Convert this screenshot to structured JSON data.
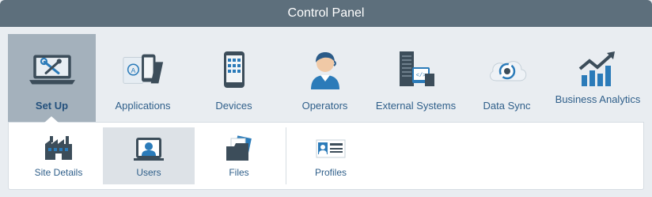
{
  "window": {
    "title": "Control Panel"
  },
  "nav": {
    "items": [
      {
        "label": "Set Up",
        "icon": "laptop-tools-icon",
        "active": true
      },
      {
        "label": "Applications",
        "icon": "applications-icon",
        "active": false
      },
      {
        "label": "Devices",
        "icon": "mobile-device-icon",
        "active": false
      },
      {
        "label": "Operators",
        "icon": "operator-icon",
        "active": false
      },
      {
        "label": "External Systems",
        "icon": "external-systems-icon",
        "active": false
      },
      {
        "label": "Data Sync",
        "icon": "data-sync-icon",
        "active": false
      },
      {
        "label": "Business Analytics",
        "icon": "business-analytics-icon",
        "active": false
      }
    ]
  },
  "subnav": {
    "items": [
      {
        "label": "Site Details",
        "icon": "site-details-icon",
        "active": false
      },
      {
        "label": "Users",
        "icon": "users-icon",
        "active": true
      },
      {
        "label": "Files",
        "icon": "files-icon",
        "active": false
      },
      {
        "label": "Profiles",
        "icon": "profiles-icon",
        "active": false
      }
    ]
  },
  "colors": {
    "titlebar": "#5d6f7c",
    "active_nav": "#a4b1bc",
    "label": "#2f5f8a",
    "accent_blue": "#2b7bb9",
    "dark_icon": "#3c4d5a"
  }
}
